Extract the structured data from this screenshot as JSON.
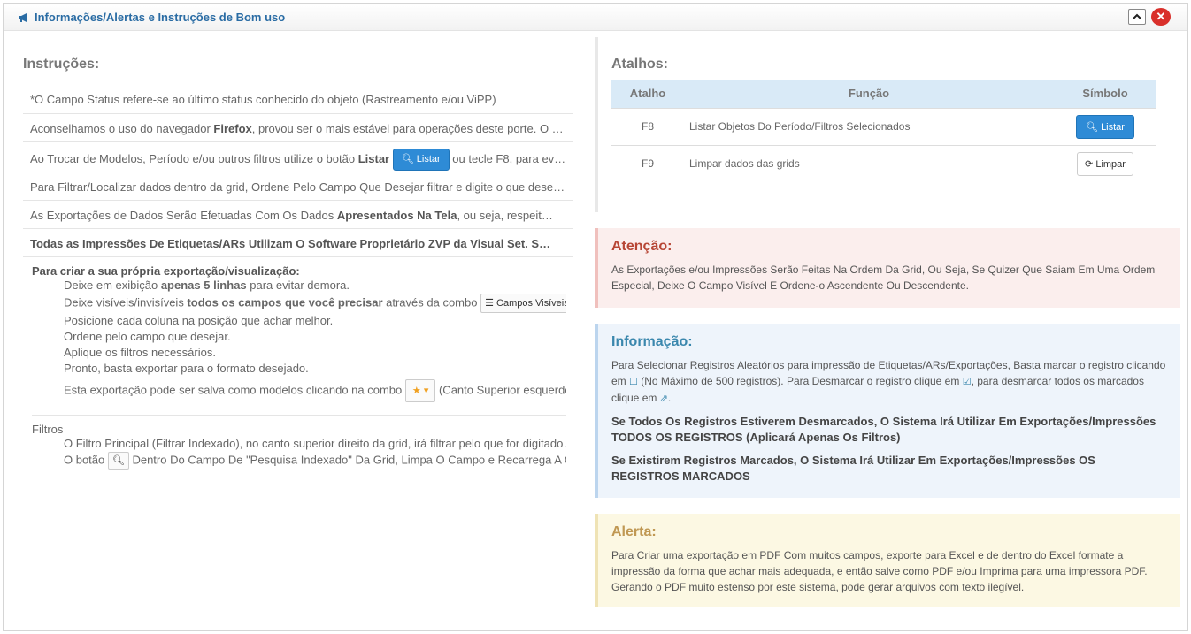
{
  "header": {
    "title": "Informações/Alertas e Instruções de Bom uso",
    "collapse_icon": "chevron-up-icon",
    "close_icon": "close-icon"
  },
  "instructions": {
    "title": "Instruções:",
    "row1": "*O Campo Status refere-se ao último status conhecido do objeto (Rastreamento e/ou ViPP)",
    "row2_pre": "Aconselhamos o uso do navegador ",
    "row2_b": "Firefox",
    "row2_post": ", provou ser o mais estável para operações deste porte. O …",
    "row3_pre": "Ao Trocar de Modelos, Período e/ou outros filtros utilize o botão ",
    "row3_b": "Listar",
    "row3_btn": "Listar",
    "row3_post": " ou tecle F8, para ev…",
    "row4": "Para Filtrar/Localizar dados dentro da grid, Ordene Pelo Campo Que Desejar filtrar e digite o que dese…",
    "row5_pre": "As Exportações de Dados Serão Efetuadas Com Os Dados ",
    "row5_b": "Apresentados Na Tela",
    "row5_post": ", ou seja, respeit…",
    "row6": "Todas as Impressões De Etiquetas/ARs Utilizam O Software Proprietário ZVP da Visual Set. S…",
    "export_title": "Para criar a sua própria exportação/visualização:",
    "steps": {
      "s1_pre": "Deixe em exibição ",
      "s1_b": "apenas 5 linhas",
      "s1_post": " para evitar demora.",
      "s2_pre": "Deixe visíveis/invisíveis ",
      "s2_b": "todos os campos que você precisar",
      "s2_post": " através da combo ",
      "s2_combo": "Campos Visíveis",
      "s3": "Posicione cada coluna na posição que achar melhor.",
      "s4": "Ordene pelo campo que desejar.",
      "s5": "Aplique os filtros necessários.",
      "s6": "Pronto, basta exportar para o formato desejado.",
      "s7_pre": "Esta exportação pode ser salva como modelos clicando na combo ",
      "s7_post": " (Canto Superior esquerdo"
    },
    "filters_title": "Filtros",
    "f1": "O Filtro Principal (Filtrar Indexado), no canto superior direito da grid, irá filtrar pelo que for digitado A",
    "f2_pre": "O botão ",
    "f2_post": " Dentro Do Campo De \"Pesquisa Indexado\" Da Grid, Limpa O Campo e Recarrega A G"
  },
  "shortcuts": {
    "title": "Atalhos:",
    "headers": [
      "Atalho",
      "Função",
      "Símbolo"
    ],
    "rows": [
      {
        "key": "F8",
        "func": "Listar Objetos Do Período/Filtros Selecionados",
        "btn": "Listar"
      },
      {
        "key": "F9",
        "func": "Limpar dados das grids",
        "btn": "Limpar"
      }
    ]
  },
  "attention": {
    "title": "Atenção:",
    "text": "As Exportações e/ou Impressões Serão Feitas Na Ordem Da Grid, Ou Seja, Se Quizer Que Saiam Em Uma Ordem Especial, Deixe O Campo Visível E Ordene-o Ascendente Ou Descendente."
  },
  "info": {
    "title": "Informação:",
    "t1": "Para Selecionar Registros Aleatórios para impressão de Etiquetas/ARs/Exportações, Basta marcar o registro clicando em ",
    "t2": " (No Máximo de 500 registros). Para Desmarcar o registro clique em ",
    "t3": ", para desmarcar todos os marcados clique em ",
    "t4": ".",
    "p2": "Se Todos Os Registros Estiverem Desmarcados, O Sistema Irá Utilizar Em Exportações/Impressões TODOS OS REGISTROS (Aplicará Apenas Os Filtros)",
    "p3": "Se Existirem Registros Marcados, O Sistema Irá Utilizar Em Exportações/Impressões OS REGISTROS MARCADOS"
  },
  "alert": {
    "title": "Alerta:",
    "text": "Para Criar uma exportação em PDF Com muitos campos, exporte para Excel e de dentro do Excel formate a impressão da forma que achar mais adequada, e então salve como PDF e/ou Imprima para uma impressora PDF. Gerando o PDF muito estenso por este sistema, pode gerar arquivos com texto ilegível."
  }
}
